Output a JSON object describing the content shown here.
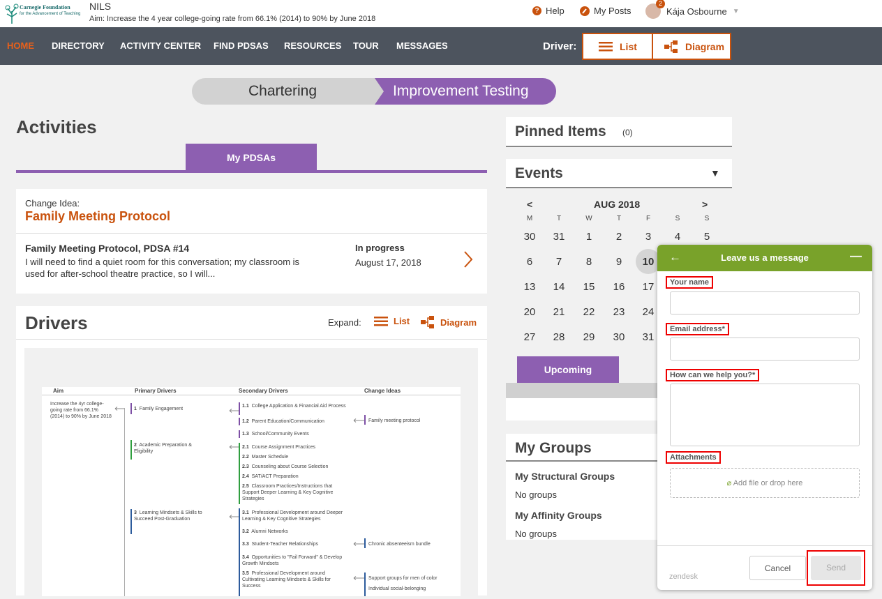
{
  "header": {
    "logo_line1": "Carnegie Foundation",
    "logo_line2": "for the Advancement of Teaching",
    "app_name": "NILS",
    "aim": "Aim:  Increase the 4 year college-going rate from 66.1% (2014) to 90% by June 2018",
    "help": "Help",
    "my_posts": "My Posts",
    "notif_count": "2",
    "user_name": "Kája Osbourne"
  },
  "nav": {
    "items": [
      "HOME",
      "DIRECTORY",
      "ACTIVITY CENTER",
      "FIND PDSAS",
      "RESOURCES",
      "TOUR",
      "MESSAGES"
    ],
    "driver_label": "Driver:",
    "list_button": "List",
    "diagram_button": "Diagram"
  },
  "phases": {
    "chartering": "Chartering",
    "improvement": "Improvement Testing"
  },
  "activities": {
    "title": "Activities",
    "tab": "My PDSAs",
    "change_idea_label": "Change Idea:",
    "change_idea_title": "Family Meeting Protocol",
    "pdsa_title": "Family Meeting Protocol, PDSA #14",
    "pdsa_desc": "I will need to find a quiet room for this conversation; my classroom is used for after-school theatre practice, so I will...",
    "status": "In progress",
    "date": "August 17, 2018"
  },
  "drivers": {
    "title": "Drivers",
    "expand_label": "Expand:",
    "list": "List",
    "diagram": "Diagram",
    "diagram_headers": {
      "aim": "Aim",
      "primary": "Primary Drivers",
      "secondary": "Secondary Drivers",
      "change": "Change Ideas"
    },
    "aim_text": "Increase the 4yr college-going rate from 66.1% (2014) to 90% by June 2018",
    "primary": [
      {
        "num": "1",
        "text": "Family Engagement"
      },
      {
        "num": "2",
        "text": "Academic Preparation & Eligibility"
      },
      {
        "num": "3",
        "text": "Learning Mindsets & Skills to Succeed Post-Graduation"
      }
    ],
    "secondary": [
      {
        "num": "1.1",
        "text": "College Application & Financial Aid Process"
      },
      {
        "num": "1.2",
        "text": "Parent Education/Communication"
      },
      {
        "num": "1.3",
        "text": "School/Community Events"
      },
      {
        "num": "2.1",
        "text": "Course Assignment Practices"
      },
      {
        "num": "2.2",
        "text": "Master Schedule"
      },
      {
        "num": "2.3",
        "text": "Counseling about Course Selection"
      },
      {
        "num": "2.4",
        "text": "SAT/ACT Preparation"
      },
      {
        "num": "2.5",
        "text": "Classroom Practices/Instructions that Support Deeper Learning & Key Cognitive Strategies"
      },
      {
        "num": "3.1",
        "text": "Professional Development around Deeper Learning & Key Cognitive Strategies"
      },
      {
        "num": "3.2",
        "text": "Alumni Networks"
      },
      {
        "num": "3.3",
        "text": "Student-Teacher Relationships"
      },
      {
        "num": "3.4",
        "text": "Opportunities to \"Fail Forward\" & Develop Growth Mindsets"
      },
      {
        "num": "3.5",
        "text": "Professional Development around Cultivating Learning Mindsets & Skills for Success"
      }
    ],
    "change_ideas": [
      "Family meeting protocol",
      "Chronic absenteeism bundle",
      "Support groups for men of color",
      "Individual social-belonging interventions"
    ]
  },
  "pinned": {
    "title": "Pinned Items",
    "count": "(0)"
  },
  "events": {
    "title": "Events",
    "month": "AUG 2018",
    "prev": "<",
    "next": ">",
    "dow": [
      "M",
      "T",
      "W",
      "T",
      "F",
      "S",
      "S"
    ],
    "weeks": [
      [
        "30",
        "31",
        "1",
        "2",
        "3",
        "4",
        "5"
      ],
      [
        "6",
        "7",
        "8",
        "9",
        "10",
        "",
        ""
      ],
      [
        "13",
        "14",
        "15",
        "16",
        "17",
        "",
        ""
      ],
      [
        "20",
        "21",
        "22",
        "23",
        "24",
        "",
        ""
      ],
      [
        "27",
        "28",
        "29",
        "30",
        "31",
        "",
        ""
      ]
    ],
    "upcoming_tab": "Upcoming"
  },
  "groups": {
    "title": "My Groups",
    "structural": "My Structural Groups",
    "structural_none": "No groups",
    "affinity": "My Affinity Groups",
    "affinity_none": "No groups"
  },
  "widget": {
    "title": "Leave us a message",
    "name_label": "Your name",
    "email_label": "Email address*",
    "help_label": "How can we help you?*",
    "attach_label": "Attachments",
    "drop_text": "Add file or drop here",
    "brand": "zendesk",
    "cancel": "Cancel",
    "send": "Send"
  },
  "colors": {
    "accent": "#c9520d",
    "purple": "#8d5fb1",
    "nav_bg": "#4d545e",
    "widget_green": "#79a22a"
  }
}
